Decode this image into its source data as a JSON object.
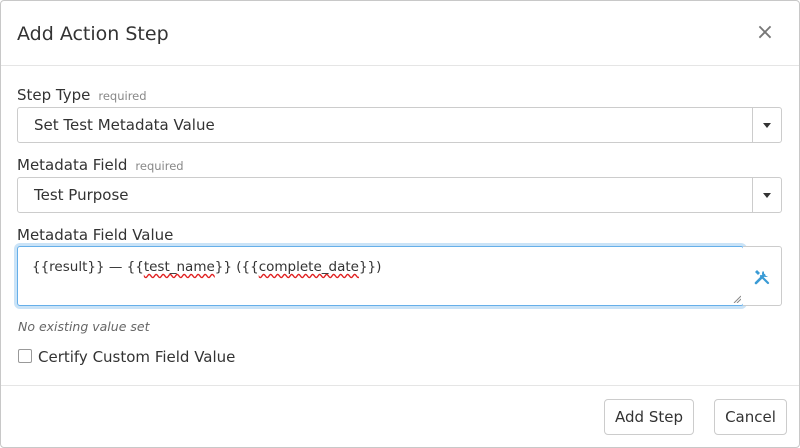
{
  "dialog": {
    "title": "Add Action Step",
    "close_label": "×"
  },
  "form": {
    "step_type": {
      "label": "Step Type",
      "required_label": "required",
      "value": "Set Test Metadata Value"
    },
    "metadata_field": {
      "label": "Metadata Field",
      "required_label": "required",
      "value": "Test Purpose"
    },
    "metadata_value": {
      "label": "Metadata Field Value",
      "value_parts": {
        "p1": "{{result}} — {{",
        "p2": "test_name",
        "p3": "}} ({{",
        "p4": "complete_date",
        "p5": "}})"
      },
      "tool_icon": "tools-icon",
      "no_value_hint": "No existing value set"
    },
    "certify": {
      "label": "Certify Custom Field Value",
      "checked": false
    }
  },
  "footer": {
    "add_step_label": "Add Step",
    "cancel_label": "Cancel"
  },
  "colors": {
    "focus_border": "#66afe9",
    "tool_icon": "#3a9bd5",
    "spellcheck": "#e02020"
  }
}
